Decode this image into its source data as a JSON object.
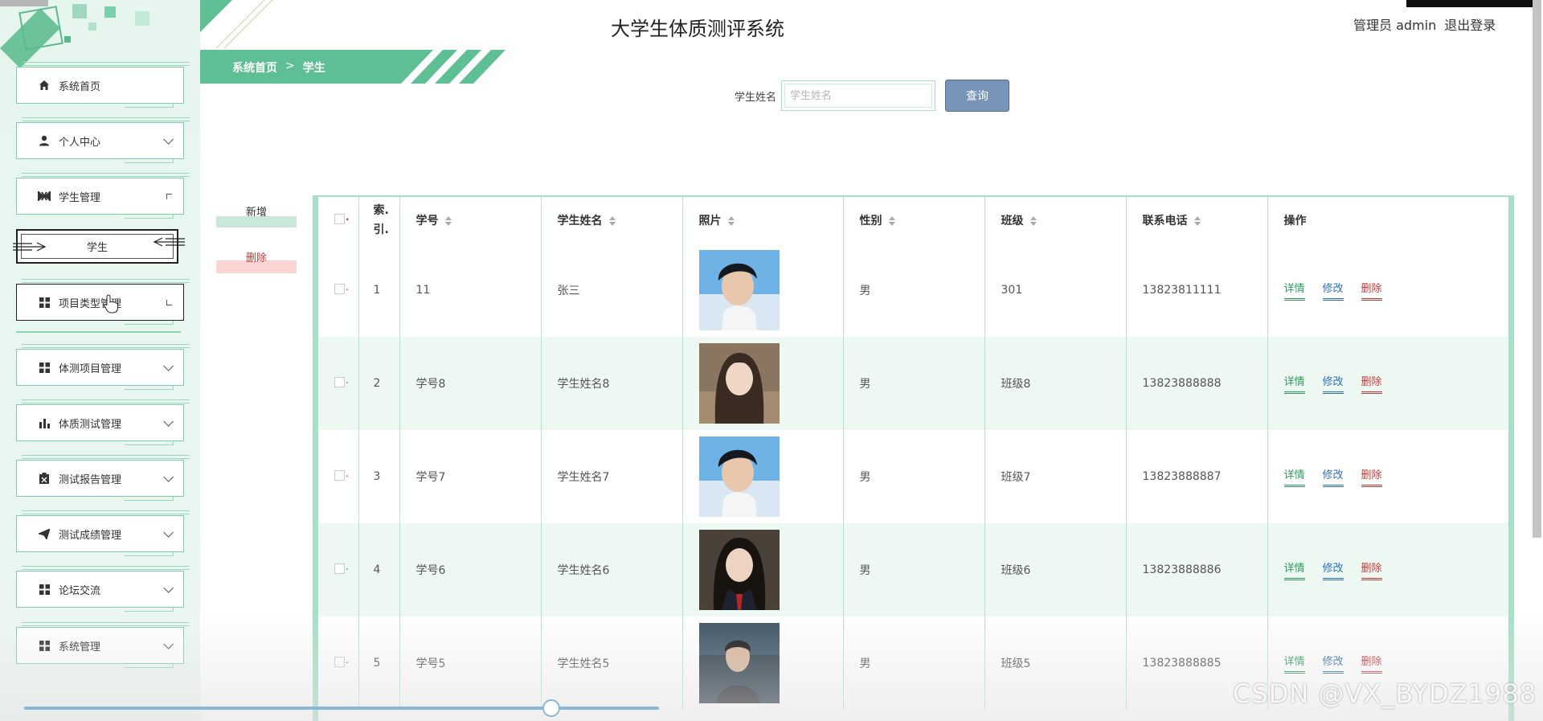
{
  "header": {
    "title": "大学生体质测评系统",
    "user_label": "管理员 admin",
    "logout_label": "退出登录"
  },
  "sidebar": {
    "items": [
      {
        "label": "系统首页",
        "icon": "home-icon"
      },
      {
        "label": "个人中心",
        "icon": "user-icon"
      },
      {
        "label": "学生管理",
        "icon": "student-icon"
      },
      {
        "label": "项目类型管理",
        "icon": "grid-icon"
      },
      {
        "label": "体测项目管理",
        "icon": "grid-icon"
      },
      {
        "label": "体质测试管理",
        "icon": "bar-chart-icon"
      },
      {
        "label": "测试报告管理",
        "icon": "clipboard-icon"
      },
      {
        "label": "测试成绩管理",
        "icon": "paper-plane-icon"
      },
      {
        "label": "论坛交流",
        "icon": "grid-icon"
      },
      {
        "label": "系统管理",
        "icon": "grid-icon"
      }
    ],
    "sub_item": "学生"
  },
  "breadcrumb": {
    "home": "系统首页",
    "separator": ">",
    "current": "学生"
  },
  "search": {
    "label": "学生姓名",
    "placeholder": "学生姓名",
    "button": "查询"
  },
  "actions": {
    "add": "新增",
    "delete": "删除"
  },
  "table": {
    "headers": {
      "index": "索.\n引.",
      "student_no": "学号",
      "name": "学生姓名",
      "photo": "照片",
      "gender": "性别",
      "class": "班级",
      "phone": "联系电话",
      "ops": "操作"
    },
    "rows": [
      {
        "index": "1",
        "student_no": "11",
        "name": "张三",
        "gender": "男",
        "class": "301",
        "phone": "13823811111"
      },
      {
        "index": "2",
        "student_no": "学号8",
        "name": "学生姓名8",
        "gender": "男",
        "class": "班级8",
        "phone": "13823888888"
      },
      {
        "index": "3",
        "student_no": "学号7",
        "name": "学生姓名7",
        "gender": "男",
        "class": "班级7",
        "phone": "13823888887"
      },
      {
        "index": "4",
        "student_no": "学号6",
        "name": "学生姓名6",
        "gender": "男",
        "class": "班级6",
        "phone": "13823888886"
      },
      {
        "index": "5",
        "student_no": "学号5",
        "name": "学生姓名5",
        "gender": "男",
        "class": "班级5",
        "phone": "13823888885"
      }
    ],
    "op_labels": {
      "detail": "详情",
      "edit": "修改",
      "remove": "删除"
    }
  },
  "slider": {
    "value": 0.83
  },
  "watermark": "CSDN @VX_BYDZ1988",
  "colors": {
    "accent_green": "#5fbf94",
    "search_button": "#7895b9",
    "detail": "#2e9b5f",
    "edit": "#2b6fbd",
    "remove": "#c53a3a"
  }
}
